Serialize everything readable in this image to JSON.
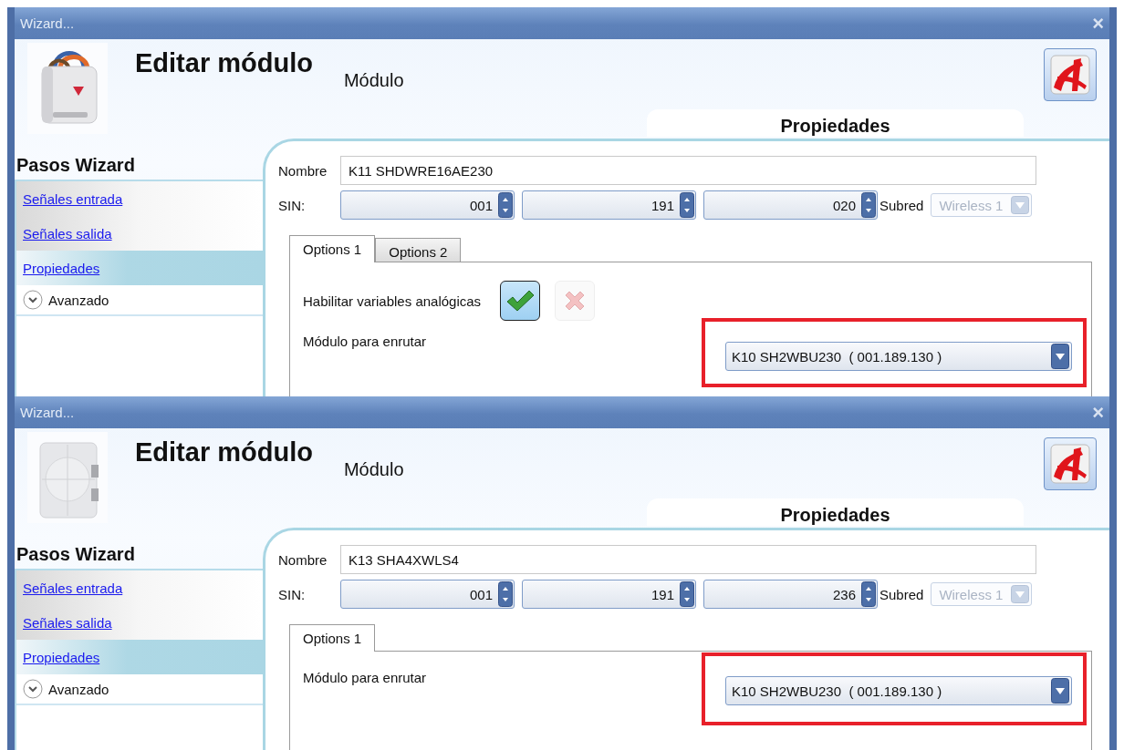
{
  "windows": [
    {
      "title": "Wizard...",
      "close": "×",
      "heading": "Editar módulo",
      "subheading": "Módulo",
      "section_tab": "Propiedades",
      "steps_title": "Pasos Wizard",
      "steps": [
        {
          "kind": "link",
          "label": "Señales entrada",
          "selected": false
        },
        {
          "kind": "link",
          "label": "Señales salida",
          "selected": false
        },
        {
          "kind": "link",
          "label": "Propiedades",
          "selected": true
        },
        {
          "kind": "expander",
          "label": "Avanzado",
          "selected": false
        }
      ],
      "name_label": "Nombre",
      "name_value": "K11 SHDWRE16AE230",
      "sin_label": "SIN:",
      "sin_values": [
        "001",
        "191",
        "020"
      ],
      "subnet_label": "Subred",
      "subnet_value": "Wireless 1",
      "subnet_disabled": true,
      "tabs": [
        {
          "label": "Options 1",
          "selected": true
        },
        {
          "label": "Options 2",
          "selected": false
        }
      ],
      "options": [
        {
          "kind": "toggle",
          "label": "Habilitar variables analógicas",
          "choices": [
            {
              "kind": "check",
              "selected": true
            },
            {
              "kind": "cross",
              "selected": false
            }
          ]
        },
        {
          "kind": "combo",
          "label": "Módulo para enrutar",
          "value": "K10 SH2WBU230  ( 001.189.130 )",
          "highlighted": true
        }
      ]
    },
    {
      "title": "Wizard...",
      "close": "×",
      "heading": "Editar módulo",
      "subheading": "Módulo",
      "section_tab": "Propiedades",
      "steps_title": "Pasos Wizard",
      "steps": [
        {
          "kind": "link",
          "label": "Señales entrada",
          "selected": false
        },
        {
          "kind": "link",
          "label": "Señales salida",
          "selected": false
        },
        {
          "kind": "link",
          "label": "Propiedades",
          "selected": true
        },
        {
          "kind": "expander",
          "label": "Avanzado",
          "selected": false
        }
      ],
      "name_label": "Nombre",
      "name_value": "K13 SHA4XWLS4",
      "sin_label": "SIN:",
      "sin_values": [
        "001",
        "191",
        "236"
      ],
      "subnet_label": "Subred",
      "subnet_value": "Wireless 1",
      "subnet_disabled": true,
      "tabs": [
        {
          "label": "Options 1",
          "selected": true
        }
      ],
      "options": [
        {
          "kind": "combo",
          "label": "Módulo para enrutar",
          "value": "K10 SH2WBU230  ( 001.189.130 )",
          "highlighted": true
        }
      ]
    }
  ]
}
